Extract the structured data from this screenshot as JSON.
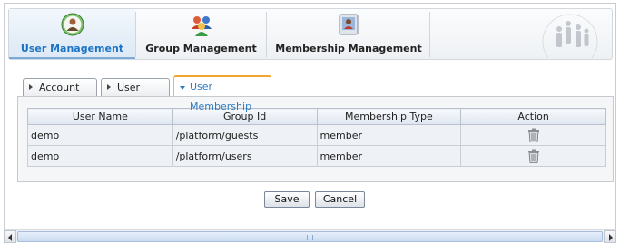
{
  "nav": {
    "items": [
      {
        "label": "User Management",
        "icon": "user-icon",
        "active": true
      },
      {
        "label": "Group Management",
        "icon": "group-icon",
        "active": false
      },
      {
        "label": "Membership Management",
        "icon": "membership-icon",
        "active": false
      }
    ]
  },
  "tabs": [
    {
      "label": "Account Info",
      "active": false
    },
    {
      "label": "User Profile",
      "active": false
    },
    {
      "label": "User Membership",
      "active": true
    }
  ],
  "table": {
    "columns": [
      "User Name",
      "Group Id",
      "Membership Type",
      "Action"
    ],
    "rows": [
      {
        "user_name": "demo",
        "group_id": "/platform/guests",
        "membership_type": "member",
        "action_icon": "trash-icon"
      },
      {
        "user_name": "demo",
        "group_id": "/platform/users",
        "membership_type": "member",
        "action_icon": "trash-icon"
      }
    ]
  },
  "buttons": {
    "save": "Save",
    "cancel": "Cancel"
  },
  "colors": {
    "active_nav_text": "#1a73c6",
    "active_tab_border": "#f0a630",
    "active_tab_text": "#2f7bc0"
  }
}
